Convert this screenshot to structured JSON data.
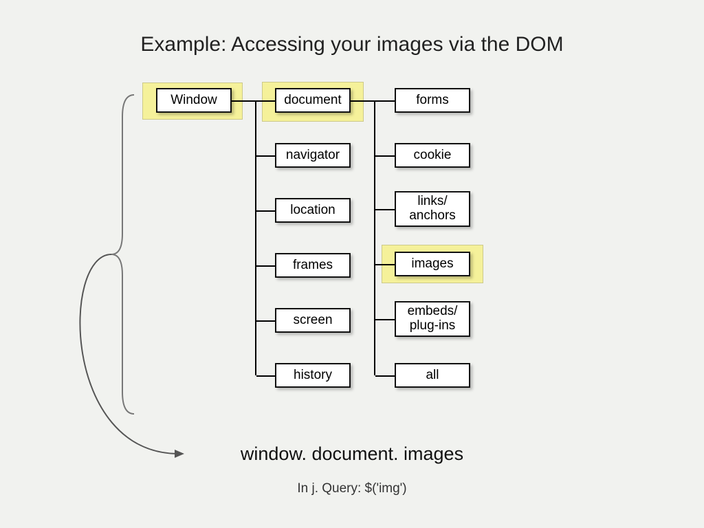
{
  "title": "Example: Accessing your images via the DOM",
  "nodes": {
    "window": "Window",
    "document": "document",
    "navigator": "navigator",
    "location": "location",
    "frames": "frames",
    "screen": "screen",
    "history": "history",
    "forms": "forms",
    "cookie": "cookie",
    "links": "links/\nanchors",
    "images": "images",
    "embeds": "embeds/\nplug-ins",
    "all": "all"
  },
  "result": "window. document. images",
  "jquery": "In j. Query:  $('img')",
  "chart_data": {
    "type": "tree",
    "root": {
      "label": "Window",
      "highlighted": true,
      "children": [
        {
          "label": "document",
          "highlighted": true,
          "children": [
            {
              "label": "forms"
            },
            {
              "label": "cookie"
            },
            {
              "label": "links/anchors"
            },
            {
              "label": "images",
              "highlighted": true
            },
            {
              "label": "embeds/plug-ins"
            },
            {
              "label": "all"
            }
          ]
        },
        {
          "label": "navigator"
        },
        {
          "label": "location"
        },
        {
          "label": "frames"
        },
        {
          "label": "screen"
        },
        {
          "label": "history"
        }
      ]
    },
    "access_path": "window.document.images",
    "jquery_equivalent": "$('img')"
  }
}
